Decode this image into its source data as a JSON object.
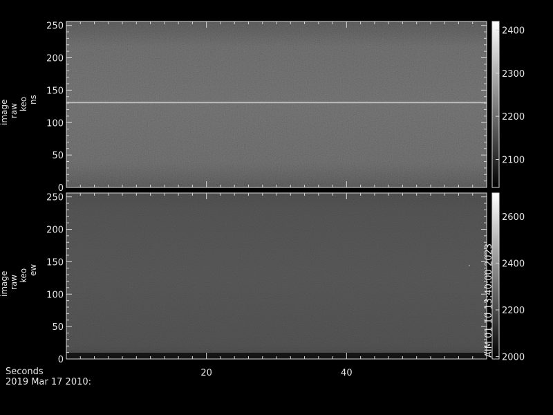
{
  "chart_data": [
    {
      "type": "heatmap",
      "name": "image raw keo ns",
      "ylabel_lines": [
        "image",
        "raw",
        "keo",
        "ns"
      ],
      "xlim": [
        0,
        60
      ],
      "ylim": [
        0,
        256
      ],
      "y_ticks": [
        0,
        50,
        100,
        150,
        200,
        250
      ],
      "x_ticks": [
        20,
        40
      ],
      "colorbar": {
        "ticks": [
          2100,
          2200,
          2300,
          2400
        ],
        "range": [
          2035,
          2420
        ]
      },
      "features": {
        "bright_line_y": 131,
        "base_level": 2150,
        "edge_darkening": true
      }
    },
    {
      "type": "heatmap",
      "name": "image raw keo ew",
      "ylabel_lines": [
        "image",
        "raw",
        "keo",
        "ew"
      ],
      "xlim": [
        0,
        60
      ],
      "ylim": [
        0,
        256
      ],
      "y_ticks": [
        0,
        50,
        100,
        150,
        200,
        250
      ],
      "x_ticks": [
        20,
        40
      ],
      "colorbar": {
        "ticks": [
          2000,
          2200,
          2400,
          2600
        ],
        "range": [
          1990,
          2700
        ]
      },
      "side_note": "AIM 01 10 13:40:00 2023",
      "features": {
        "base_level": 2150,
        "dark_bottom_band": true
      }
    }
  ],
  "footer": {
    "xlabel": "Seconds",
    "date": "2019 Mar 17 2010:"
  }
}
